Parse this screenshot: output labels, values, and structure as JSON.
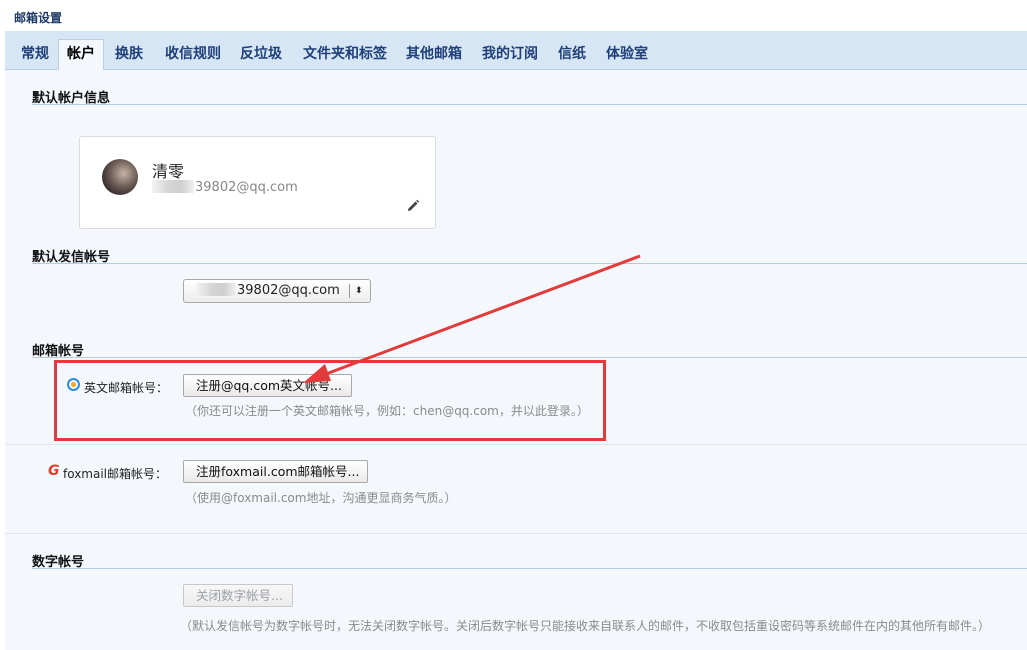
{
  "page": {
    "title": "邮箱设置"
  },
  "tabs": [
    {
      "label": "常规",
      "active": false
    },
    {
      "label": "帐户",
      "active": true
    },
    {
      "label": "换肤",
      "active": false
    },
    {
      "label": "收信规则",
      "active": false
    },
    {
      "label": "反垃圾",
      "active": false
    },
    {
      "label": "文件夹和标签",
      "active": false
    },
    {
      "label": "其他邮箱",
      "active": false
    },
    {
      "label": "我的订阅",
      "active": false
    },
    {
      "label": "信纸",
      "active": false
    },
    {
      "label": "体验室",
      "active": false
    }
  ],
  "default_account": {
    "title": "默认帐户信息",
    "name": "清零",
    "email_visible": "39802@qq.com"
  },
  "default_sender": {
    "title": "默认发信帐号",
    "selected_visible": "39802@qq.com",
    "arrows": "⬍"
  },
  "mailbox_accounts": {
    "title": "邮箱帐号",
    "english": {
      "label": "英文邮箱帐号：",
      "button": "注册@qq.com英文帐号...",
      "hint": "（你还可以注册一个英文邮箱帐号，例如：chen@qq.com，并以此登录。）"
    },
    "foxmail": {
      "icon_glyph": "G",
      "label": "foxmail邮箱帐号：",
      "button": "注册foxmail.com邮箱帐号...",
      "hint": "（使用@foxmail.com地址，沟通更显商务气质。）"
    }
  },
  "numeric_account": {
    "title": "数字帐号",
    "button": "关闭数字帐号...",
    "hint": "（默认发信帐号为数字帐号时，无法关闭数字帐号。关闭后数字帐号只能接收来自联系人的邮件，不收取包括重设密码等系统邮件在内的其他所有邮件。）"
  },
  "colors": {
    "tab_bar": "#d7e6f5",
    "content_bg": "#f4f8fc",
    "annotation_red": "#e23b3b"
  }
}
